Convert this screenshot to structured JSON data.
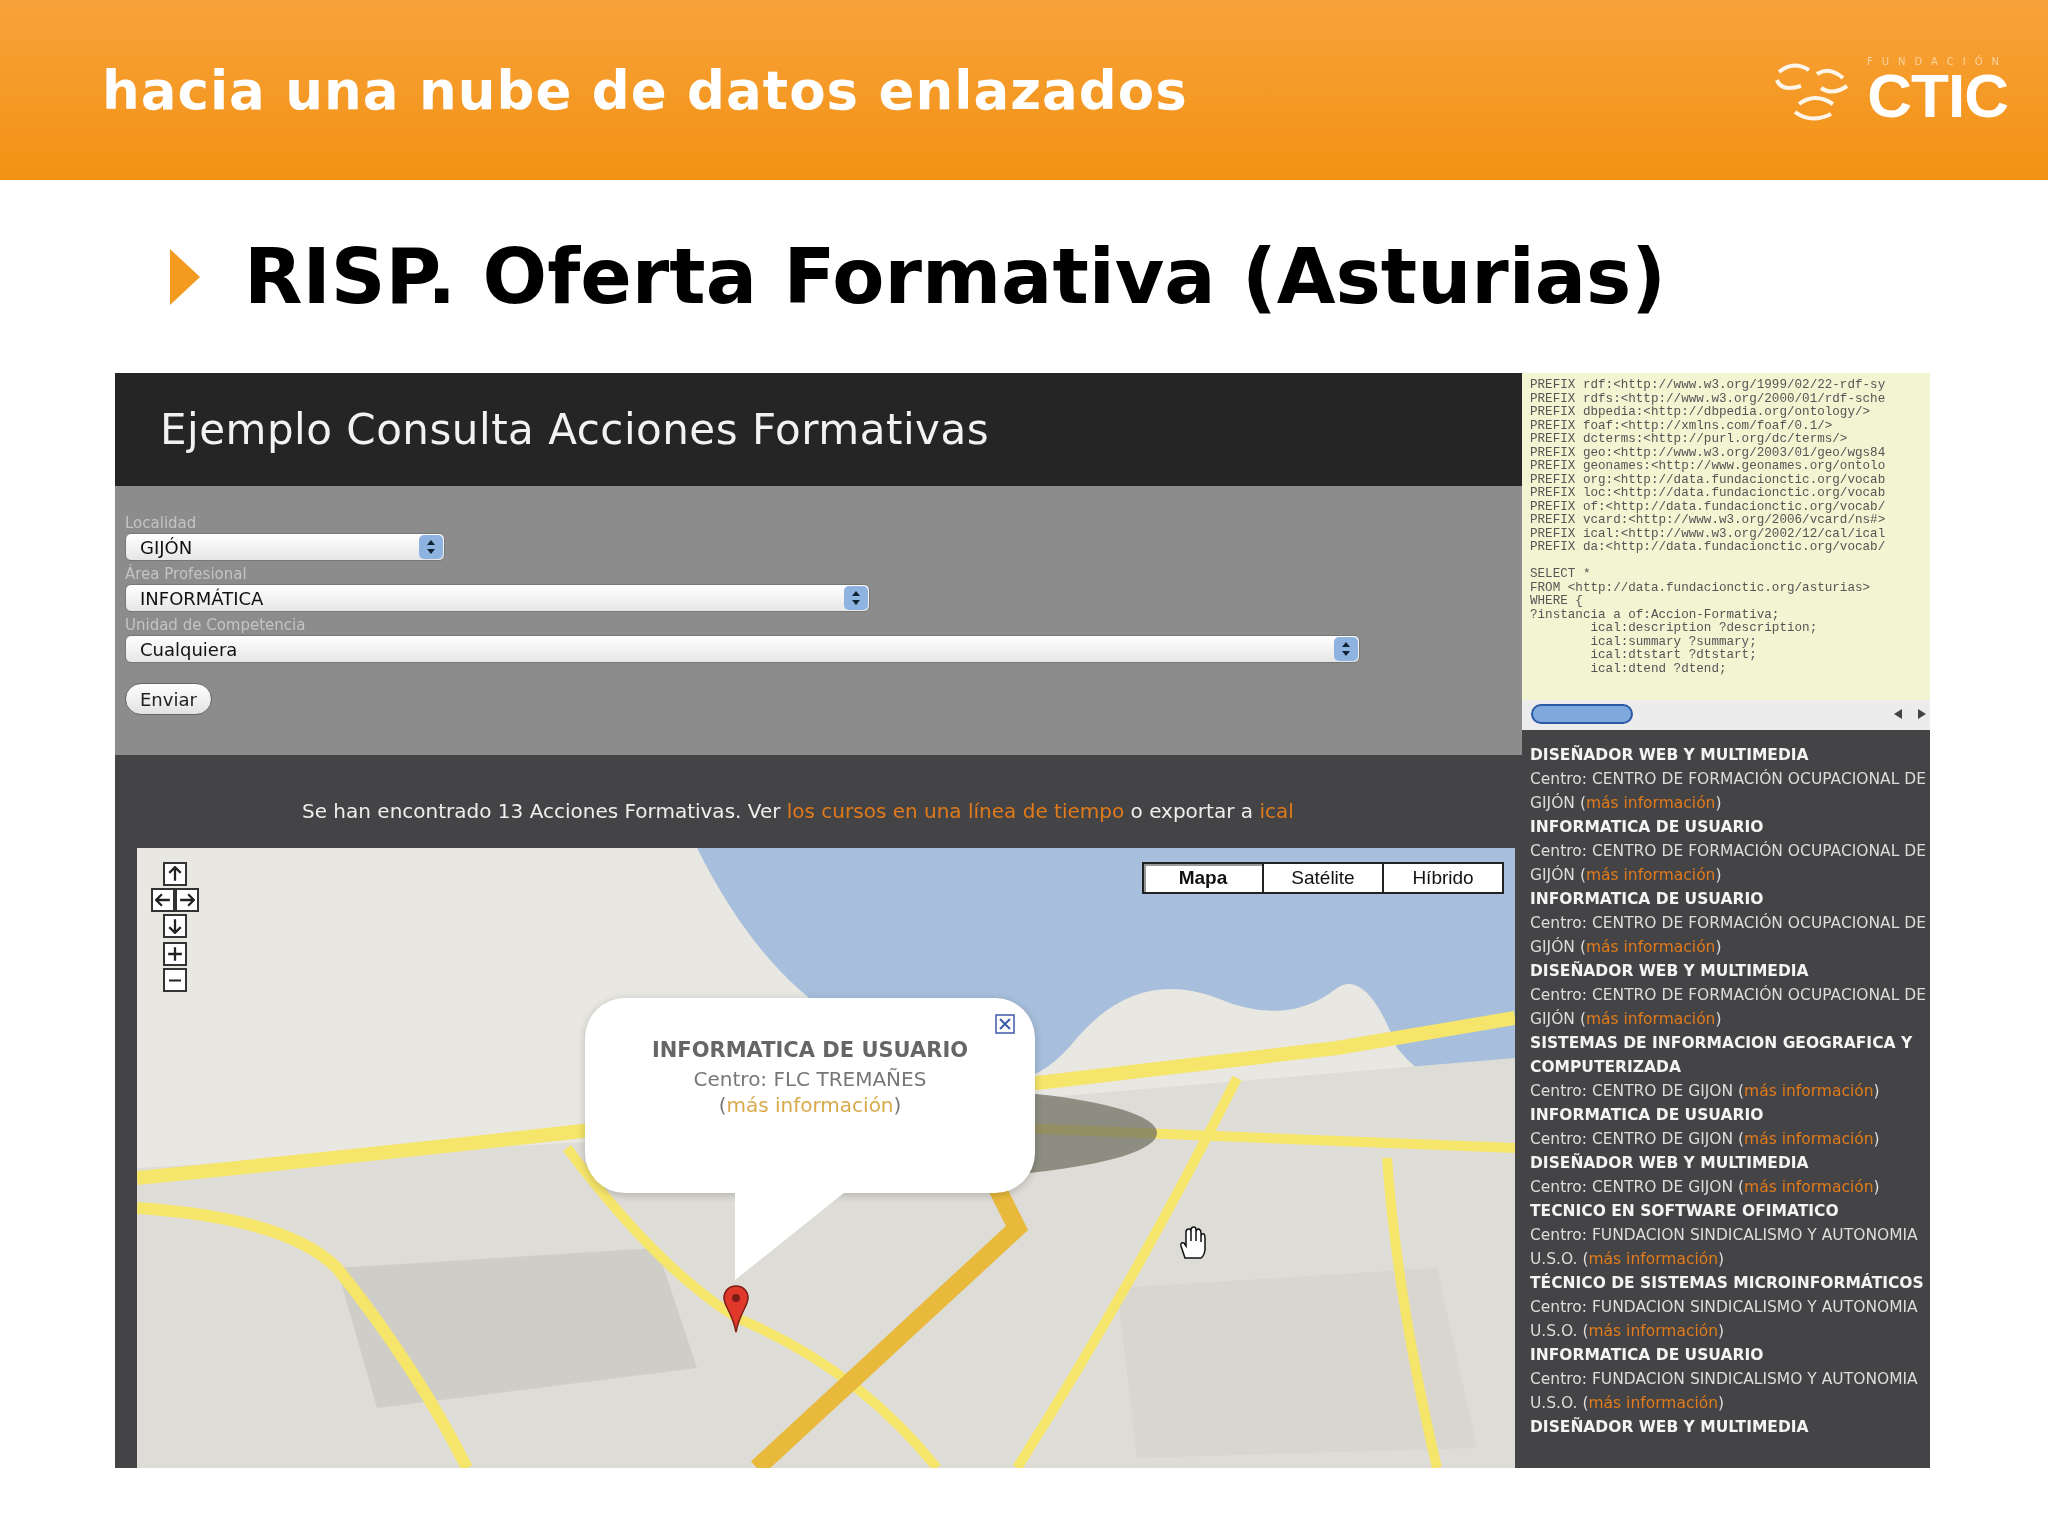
{
  "slide": {
    "header_title": "hacia una nube de datos enlazados",
    "logo": {
      "small": "FUNDACIÓN",
      "big": "CTIC"
    },
    "title": "RISP. Oferta Formativa (Asturias)"
  },
  "page": {
    "title": "Ejemplo Consulta Acciones Formativas",
    "form": [
      {
        "label": "Localidad",
        "value": "GIJÓN"
      },
      {
        "label": "Área Profesional",
        "value": "INFORMÁTICA"
      },
      {
        "label": "Unidad de Competencia",
        "value": "Cualquiera"
      }
    ],
    "submit": "Enviar",
    "results": {
      "before": "Se han encontrado 13 Acciones Formativas. Ver",
      "link": "los cursos en una línea de tiempo",
      "middle": "o exportar a",
      "link2": "ical"
    },
    "map": {
      "kind": "picture",
      "map_types": [
        {
          "label": "Mapa",
          "selected": true
        },
        {
          "label": "Satélite",
          "selected": false
        },
        {
          "label": "Híbrido",
          "selected": false
        }
      ],
      "popup": {
        "title": "INFORMATICA DE USUARIO",
        "centro": "Centro: FLC TREMAÑES (",
        "link": "más información",
        "after": ")"
      }
    },
    "sparql": {
      "prefixes": [
        "PREFIX rdf:<http://www.w3.org/1999/02/22-rdf-sy",
        "PREFIX rdfs:<http://www.w3.org/2000/01/rdf-sche",
        "PREFIX dbpedia:<http://dbpedia.org/ontology/>",
        "PREFIX foaf:<http://xmlns.com/foaf/0.1/>",
        "PREFIX dcterms:<http://purl.org/dc/terms/>",
        "PREFIX geo:<http://www.w3.org/2003/01/geo/wgs84",
        "PREFIX geonames:<http://www.geonames.org/ontolo",
        "PREFIX org:<http://data.fundacionctic.org/vocab",
        "PREFIX loc:<http://data.fundacionctic.org/vocab",
        "PREFIX of:<http://data.fundacionctic.org/vocab/",
        "PREFIX vcard:<http://www.w3.org/2006/vcard/ns#>",
        "PREFIX ical:<http://www.w3.org/2002/12/cal/ical",
        "PREFIX da:<http://data.fundacionctic.org/vocab/"
      ],
      "query": [
        "SELECT *",
        "FROM <http://data.fundacionctic.org/asturias>",
        "WHERE {",
        "?instancia a of:Accion-Formativa;",
        "        ical:description ?description;",
        "        ical:summary ?summary;",
        "        ical:dtstart ?dtstart;",
        "        ical:dtend ?dtend;"
      ]
    },
    "courses": [
      {
        "title": "DISEÑADOR WEB Y MULTIMEDIA",
        "centro": "Centro: CENTRO DE FORMACIÓN OCUPACIONAL DE GIJÓN (",
        "link": "más información",
        "after": ")"
      },
      {
        "title": "INFORMATICA DE USUARIO",
        "centro": "Centro: CENTRO DE FORMACIÓN OCUPACIONAL DE GIJÓN (",
        "link": "más información",
        "after": ")"
      },
      {
        "title": "INFORMATICA DE USUARIO",
        "centro": "Centro: CENTRO DE FORMACIÓN OCUPACIONAL DE GIJÓN (",
        "link": "más información",
        "after": ")"
      },
      {
        "title": "DISEÑADOR WEB Y MULTIMEDIA",
        "centro": "Centro: CENTRO DE FORMACIÓN OCUPACIONAL DE GIJÓN (",
        "link": "más información",
        "after": ")"
      },
      {
        "title": "SISTEMAS DE INFORMACION GEOGRAFICA Y COMPUTERIZADA",
        "centro": "Centro: CENTRO DE GIJON (",
        "link": "más información",
        "after": ")"
      },
      {
        "title": "INFORMATICA DE USUARIO",
        "centro": "Centro: CENTRO DE GIJON (",
        "link": "más información",
        "after": ")"
      },
      {
        "title": "DISEÑADOR WEB Y MULTIMEDIA",
        "centro": "Centro: CENTRO DE GIJON (",
        "link": "más información",
        "after": ")"
      },
      {
        "title": "TECNICO EN SOFTWARE OFIMATICO",
        "centro": "Centro: FUNDACION SINDICALISMO Y AUTONOMIA U.S.O. (",
        "link": "más información",
        "after": ")"
      },
      {
        "title": "TÉCNICO DE SISTEMAS MICROINFORMÁTICOS",
        "centro": "Centro: FUNDACION SINDICALISMO Y AUTONOMIA U.S.O. (",
        "link": "más información",
        "after": ")"
      },
      {
        "title": "INFORMATICA DE USUARIO",
        "centro": "Centro: FUNDACION SINDICALISMO Y AUTONOMIA U.S.O. (",
        "link": "más información",
        "after": ")"
      },
      {
        "title": "DISEÑADOR WEB Y MULTIMEDIA"
      }
    ]
  }
}
